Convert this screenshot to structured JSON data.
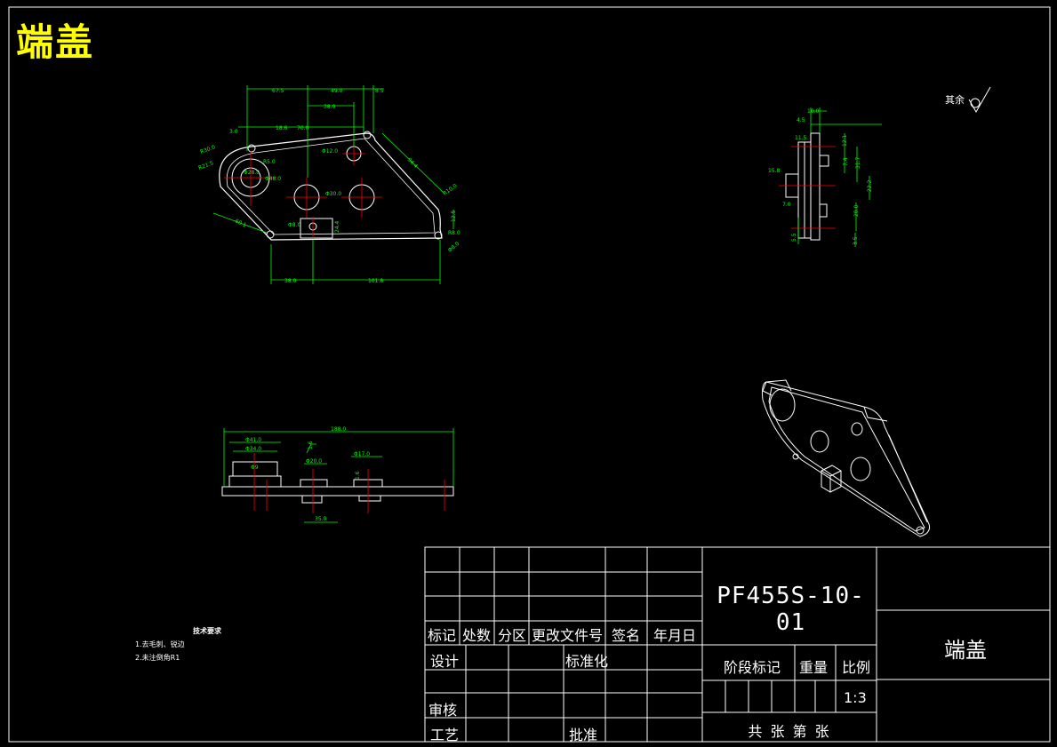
{
  "drawing": {
    "title": "端盖",
    "roughness_note": "其余",
    "tech_requirements": {
      "title": "技术要求",
      "items": [
        "1.去毛刺、锐边",
        "2.未注倒角R1"
      ]
    }
  },
  "front_view_dims": {
    "top_chain": [
      "67.5",
      "49.0",
      "8.5"
    ],
    "second_row": [
      "38.0"
    ],
    "third_row": [
      "18.6",
      "70.0"
    ],
    "left_small": "3.0",
    "radii": [
      "R30.0",
      "R21.5",
      "R5.0"
    ],
    "holes": [
      "Φ28.0",
      "Φ48.0",
      "Φ12.0",
      "Φ30.0",
      "Φ8.0"
    ],
    "side_dims": [
      "94.4",
      "R10.0",
      "12.5",
      "R8.0",
      "Φ8.0",
      "24.4",
      "60.1"
    ],
    "bottom_chain": [
      "38.0",
      "101.8"
    ]
  },
  "side_view_dims": [
    "10.0",
    "4.5",
    "11.5",
    "12.1",
    "7.4",
    "31.7",
    "15.8",
    "22.2",
    "7.0",
    "20.0",
    "5.5",
    "3.5"
  ],
  "bottom_view_dims": [
    "188.0",
    "Φ41.0",
    "Φ34.0",
    "Φ20.0",
    "Φ17.0",
    "1.6",
    "1.6",
    "35.0",
    "Φ9"
  ],
  "title_block": {
    "drawing_number": "PF455S-10-01",
    "part_name": "端盖",
    "header": [
      "标记",
      "处数",
      "分区",
      "更改文件号",
      "签名",
      "年月日"
    ],
    "design": "设计",
    "standardization": "标准化",
    "review": "审核",
    "process": "工艺",
    "approve": "批准",
    "stage_mark": "阶段标记",
    "weight": "重量",
    "scale_label": "比例",
    "scale_value": "1:3",
    "sheet_info": "共  张  第  张"
  },
  "colors": {
    "background": "#000000",
    "lines": "#ffffff",
    "dimensions": "#00ff00",
    "centerlines": "#ff0000",
    "title": "#ffff00"
  }
}
